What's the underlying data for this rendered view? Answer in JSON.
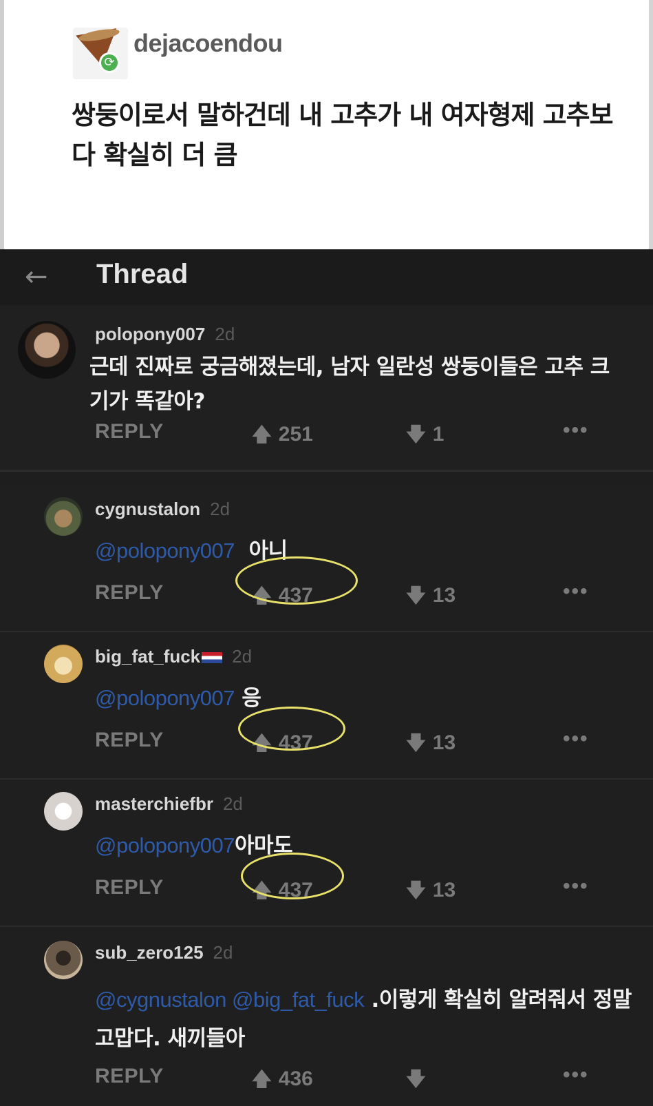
{
  "post": {
    "username": "dejacoendou",
    "text": "쌍둥이로서 말하건데 내 고추가 내 여자형제 고추보다 확실히 더 큼"
  },
  "thread": {
    "title": "Thread",
    "comments": [
      {
        "username": "polopony007",
        "age": "2d",
        "mention": "",
        "text": "근데 진짜로 궁금해졌는데, 남자 일란성 쌍둥이들은 고추 크기가 똑같아?",
        "reply_label": "REPLY",
        "upvotes": "251",
        "downvotes": "1",
        "more": "•••"
      },
      {
        "username": "cygnustalon",
        "age": "2d",
        "mention": "@polopony007",
        "text": "아니",
        "reply_label": "REPLY",
        "upvotes": "437",
        "downvotes": "13",
        "more": "•••"
      },
      {
        "username": "big_fat_fuck",
        "age": "2d",
        "mention": "@polopony007",
        "text": "응",
        "reply_label": "REPLY",
        "upvotes": "437",
        "downvotes": "13",
        "more": "•••"
      },
      {
        "username": "masterchiefbr",
        "age": "2d",
        "mention": "@polopony007",
        "text": "아마도",
        "reply_label": "REPLY",
        "upvotes": "437",
        "downvotes": "13",
        "more": "•••"
      },
      {
        "username": "sub_zero125",
        "age": "2d",
        "mention": "@cygnustalon @big_fat_fuck",
        "text": ".이렇게 확실히 알려줘서 정말 고맙다. 새끼들아",
        "reply_label": "REPLY",
        "upvotes": "436",
        "downvotes": "",
        "more": "•••"
      }
    ]
  },
  "icons": {
    "back": "arrow-left-icon",
    "upvote": "arrow-up-icon",
    "downvote": "arrow-down-icon",
    "more": "more-dots-icon",
    "reblog": "reblog-icon"
  },
  "colors": {
    "mention": "#2e5aa8",
    "highlight_ring": "#e9e26a",
    "thread_bg": "#1e1e1e"
  }
}
